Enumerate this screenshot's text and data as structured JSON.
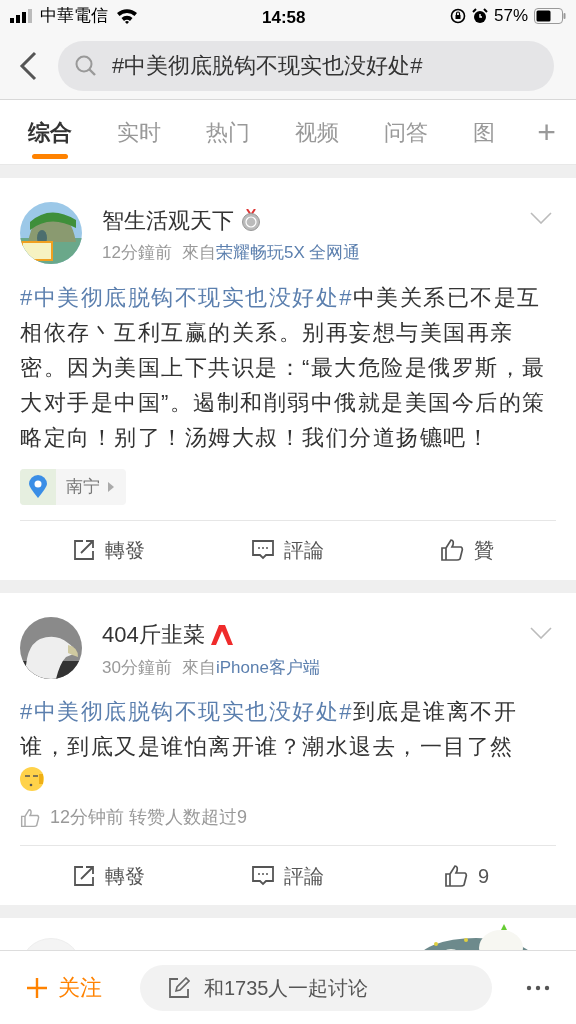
{
  "status_bar": {
    "carrier": "中華電信",
    "time": "14:58",
    "battery": "57%"
  },
  "search": {
    "value": "#中美彻底脱钩不现实也没好处#"
  },
  "tabs": [
    {
      "label": "综合",
      "selected": true
    },
    {
      "label": "实时",
      "selected": false
    },
    {
      "label": "热门",
      "selected": false
    },
    {
      "label": "视频",
      "selected": false
    },
    {
      "label": "问答",
      "selected": false
    },
    {
      "label": "图",
      "selected": false
    }
  ],
  "tab_add": "+",
  "posts": [
    {
      "author": "智生活观天下",
      "badge": {
        "kind": "medal"
      },
      "time": "12分鐘前",
      "source_prefix": "來自",
      "source": "荣耀畅玩5X 全网通",
      "topic": "#中美彻底脱钩不现实也没好处#",
      "text": "中美关系已不是互相依存丶互利互赢的关系。别再妄想与美国再亲密。因为美国上下共识是：“最大危险是俄罗斯，最大对手是中国”。遏制和削弱中俄就是美国今后的策略定向！别了！汤姆大叔！我们分道扬镳吧！",
      "emoji": false,
      "location": "南宁",
      "actions": [
        "轉發",
        "評論",
        "贊"
      ]
    },
    {
      "author": "404斤韭菜",
      "badge": {
        "kind": "red-a"
      },
      "time": "30分鐘前",
      "source_prefix": "來自",
      "source": "iPhone客户端",
      "topic": "#中美彻底脱钩不现实也没好处#",
      "text": "到底是谁离不开谁，到底又是谁怕离开谁？潮水退去，一目了然",
      "emoji": true,
      "like_note": "12分钟前 转赞人数超过9",
      "actions": [
        "轉發",
        "評論",
        "9"
      ]
    }
  ],
  "bottom_bar": {
    "follow": "关注",
    "discuss": "和1735人一起讨论"
  }
}
